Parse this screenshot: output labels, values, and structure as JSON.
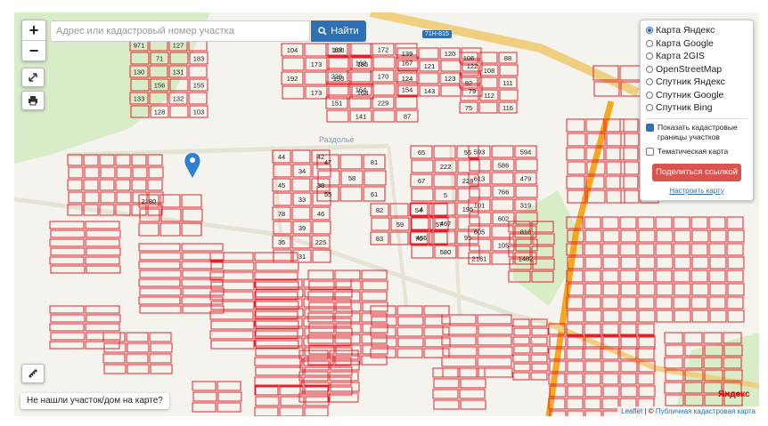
{
  "search": {
    "placeholder": "Адрес или кадастровый номер участка",
    "button_label": "Найти"
  },
  "zoom": {
    "in_label": "+",
    "out_label": "−"
  },
  "layers": {
    "options": [
      "Карта Яндекс",
      "Карта Google",
      "Карта 2GIS",
      "OpenStreetMap",
      "Спутник Яндекс",
      "Спутник Google",
      "Спутник Bing"
    ],
    "selected": "Карта Яндекс",
    "show_borders_label": "Показать кадастровые границы участков",
    "show_borders_checked": true,
    "thematic_label": "Тематическая карта",
    "thematic_checked": false,
    "share_label": "Поделиться ссылкой",
    "settings_link": "Настроить карту"
  },
  "not_found_label": "Не нашли участок/дом на карте?",
  "attribution": {
    "leaflet": "Leaflet",
    "separator": " | © ",
    "source": "Публичная кадастровая карта"
  },
  "map": {
    "place_label": "Раздолье",
    "road_badges": [
      "71Н-815"
    ],
    "provider_logo": "Яндекс",
    "colors": {
      "parcel": "#e0232c",
      "road": "#f0d080",
      "highway": "#f5a623",
      "green": "#d8ecc8"
    },
    "parcel_numbers": [
      "971",
      "127",
      "71",
      "183",
      "130",
      "131",
      "156",
      "155",
      "133",
      "132",
      "128",
      "103",
      "104",
      "100",
      "173",
      "185",
      "192",
      "193",
      "173",
      "168",
      "169",
      "172",
      "162",
      "167",
      "226",
      "170",
      "164",
      "154",
      "151",
      "229",
      "141",
      "87",
      "139",
      "120",
      "121",
      "122",
      "124",
      "123",
      "143",
      "79",
      "106",
      "88",
      "108",
      "92",
      "111",
      "112",
      "75",
      "116",
      "44",
      "42",
      "34",
      "45",
      "38",
      "33",
      "78",
      "46",
      "39",
      "35",
      "225",
      "31",
      "47",
      "81",
      "58",
      "55",
      "61",
      "82",
      "54",
      "59",
      "57",
      "83",
      "70",
      "65",
      "56",
      "222",
      "67",
      "228",
      "5",
      "4",
      "195",
      "467",
      "466",
      "95",
      "580",
      "593",
      "594",
      "586",
      "613",
      "479",
      "766",
      "101",
      "319",
      "602",
      "605",
      "818",
      "105",
      "2161",
      "1482",
      "2180"
    ]
  },
  "icons": [
    "search-icon",
    "expand-icon",
    "print-icon",
    "ruler-icon",
    "map-pin-icon",
    "map-layers-icon"
  ]
}
